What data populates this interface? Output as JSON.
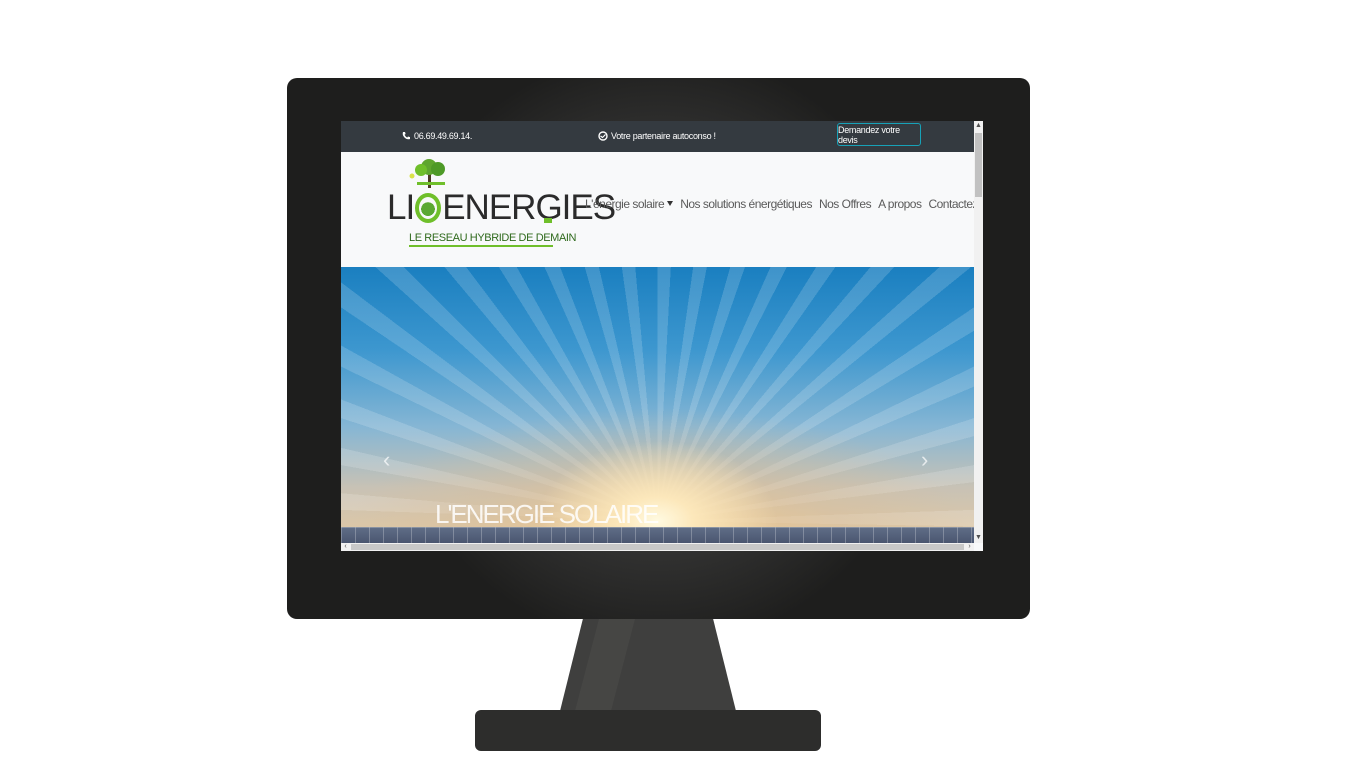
{
  "topbar": {
    "phone": "06.69.49.69.14.",
    "tagline": "Votre partenaire autoconso !",
    "quote_button": "Demandez votre devis"
  },
  "logo": {
    "text_prefix": "LI",
    "text_suffix": "ENERGIES",
    "subtitle": "LE RESEAU HYBRIDE DE DEMAIN"
  },
  "nav": {
    "items": [
      {
        "label": "L'énergie solaire"
      },
      {
        "label": "Nos solutions énergétiques"
      },
      {
        "label": "Nos Offres"
      },
      {
        "label": "A propos"
      },
      {
        "label": "Contactez-nous"
      }
    ]
  },
  "hero": {
    "title": "L'ENERGIE SOLAIRE",
    "prev": "‹",
    "next": "›"
  },
  "colors": {
    "topbar_bg": "#343a40",
    "accent_green": "#6fbf2a",
    "button_border": "#17a2b8"
  },
  "icons": [
    "phone-icon",
    "handshake-icon",
    "chevron-left-icon",
    "chevron-right-icon",
    "chat-icon"
  ]
}
